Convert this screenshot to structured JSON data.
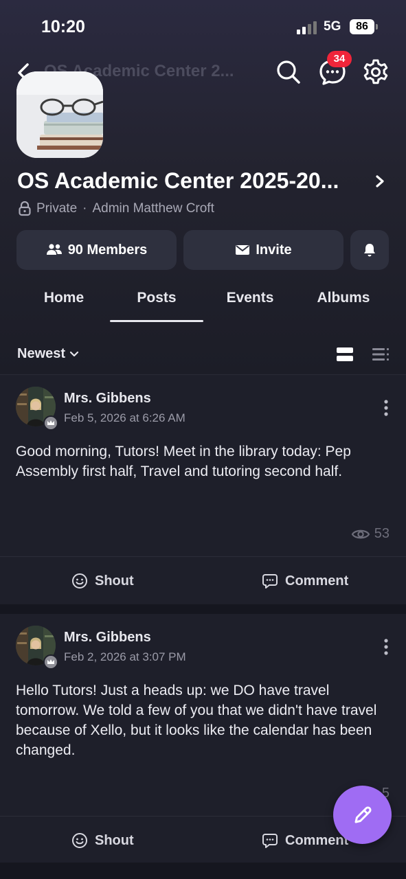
{
  "status_bar": {
    "time": "10:20",
    "network": "5G",
    "battery": "86"
  },
  "nav": {
    "title": "OS Academic Center 2...",
    "chat_badge": "34"
  },
  "group": {
    "title": "OS Academic Center 2025-20...",
    "privacy": "Private",
    "admin": "Admin Matthew Croft",
    "members_label": "90 Members",
    "invite_label": "Invite"
  },
  "tabs": [
    {
      "label": "Home"
    },
    {
      "label": "Posts"
    },
    {
      "label": "Events"
    },
    {
      "label": "Albums"
    }
  ],
  "active_tab": "Posts",
  "sort": {
    "label": "Newest"
  },
  "posts": [
    {
      "author": "Mrs. Gibbens",
      "date": "Feb 5, 2026 at 6:26 AM",
      "text": "Good morning, Tutors! Meet in the library today: Pep Assembly first half, Travel and tutoring second half.",
      "views": "53",
      "shout_label": "Shout",
      "comment_label": "Comment"
    },
    {
      "author": "Mrs. Gibbens",
      "date": "Feb 2, 2026 at 3:07 PM",
      "text": "Hello Tutors! Just a heads up: we DO have travel tomorrow. We told a few of you that we didn't have travel because of Xello, but it looks like the calendar has been changed.",
      "views": "5",
      "shout_label": "Shout",
      "comment_label": "Comment"
    }
  ],
  "colors": {
    "accent": "#9f6cf3",
    "badge": "#f0253a",
    "background": "#1e1f2a"
  },
  "icons": [
    "back-icon",
    "search-icon",
    "chat-icon",
    "gear-icon",
    "lock-icon",
    "members-icon",
    "mail-icon",
    "bell-icon",
    "chevron-down-icon",
    "card-view-icon",
    "list-view-icon",
    "more-icon",
    "eye-icon",
    "smile-icon",
    "comment-icon",
    "pencil-icon",
    "crown-icon"
  ]
}
